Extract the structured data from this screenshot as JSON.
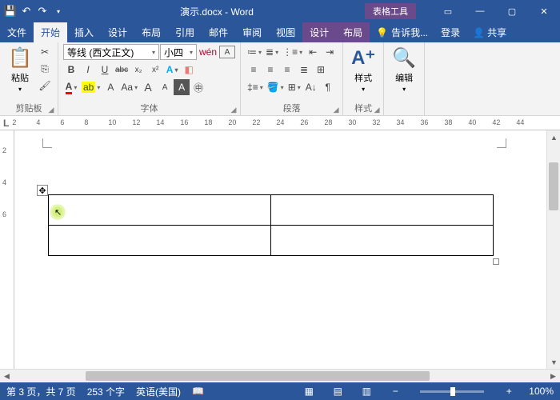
{
  "title": "演示.docx - Word",
  "contextTabHeader": "表格工具",
  "qat": {
    "save": "💾"
  },
  "tabs": {
    "file": "文件",
    "home": "开始",
    "insert": "插入",
    "design": "设计",
    "layout": "布局",
    "references": "引用",
    "mailings": "邮件",
    "review": "审阅",
    "view": "视图",
    "ctx_design": "设计",
    "ctx_layout": "布局"
  },
  "tellMe": "告诉我...",
  "login": "登录",
  "share": "共享",
  "ribbon": {
    "clipboard": {
      "label": "剪贴板",
      "paste": "粘贴"
    },
    "font": {
      "label": "字体",
      "nameValue": "等线 (西文正文)",
      "sizeValue": "小四",
      "bold": "B",
      "italic": "I",
      "underline": "U",
      "strike": "abc",
      "sub": "x₂",
      "sup": "x²",
      "pinyin": "拼",
      "charborder": "A",
      "grow": "A",
      "shrink": "A",
      "clear": "Aa",
      "case": "A"
    },
    "paragraph": {
      "label": "段落"
    },
    "styles": {
      "label": "样式",
      "btn": "样式"
    },
    "editing": {
      "label": "编辑",
      "btn": "编辑"
    }
  },
  "ruler": {
    "unit": "L",
    "ticks": [
      2,
      4,
      6,
      8,
      10,
      12,
      14,
      16,
      18,
      20,
      22,
      24,
      26,
      28,
      30,
      32,
      34,
      36,
      38,
      40,
      42,
      44
    ]
  },
  "vruler": [
    2,
    4,
    6
  ],
  "status": {
    "page": "第 3 页，共 7 页",
    "words": "253 个字",
    "lang": "英语(美国)",
    "zoom": "100%"
  },
  "chart_data": null
}
